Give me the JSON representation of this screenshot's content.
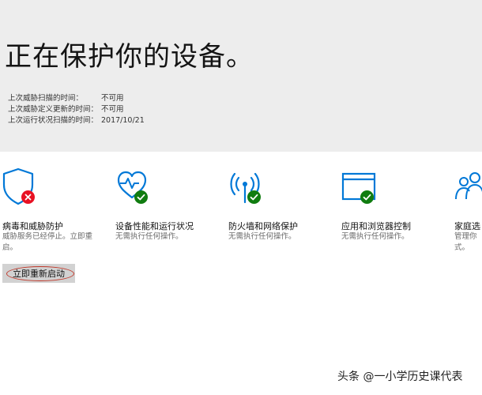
{
  "header": {
    "title": "正在保护你的设备。",
    "scan_info": [
      {
        "label": "上次威胁扫描的时间：",
        "value": "不可用"
      },
      {
        "label": "上次威胁定义更新的时间：",
        "value": "不可用"
      },
      {
        "label": "上次运行状况扫描的时间：",
        "value": "2017/10/21"
      }
    ]
  },
  "tiles": [
    {
      "icon": "shield-icon",
      "status": "error",
      "name": "病毒和威胁防护",
      "desc": "威胁服务已经停止。立即重启。"
    },
    {
      "icon": "heart-icon",
      "status": "ok",
      "name": "设备性能和运行状况",
      "desc": "无需执行任何操作。"
    },
    {
      "icon": "wifi-antenna-icon",
      "status": "ok",
      "name": "防火墙和网络保护",
      "desc": "无需执行任何操作。"
    },
    {
      "icon": "browser-window-icon",
      "status": "ok",
      "name": "应用和浏览器控制",
      "desc": "无需执行任何操作。"
    },
    {
      "icon": "family-icon",
      "status": "none",
      "name": "家庭选",
      "desc": "管理你式。"
    }
  ],
  "actions": {
    "restart_label": "立即重新启动"
  },
  "watermark": "头条 @一小学历史课代表",
  "colors": {
    "accent": "#0078d7",
    "ok": "#107c10",
    "error": "#e81123",
    "hero_bg": "#ededed"
  }
}
